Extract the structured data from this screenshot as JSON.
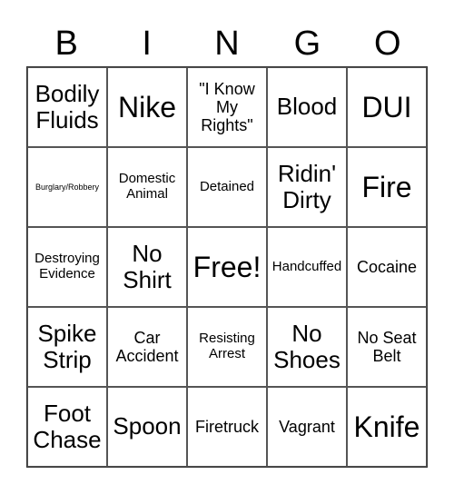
{
  "header": [
    "B",
    "I",
    "N",
    "G",
    "O"
  ],
  "cells": [
    {
      "text": "Bodily Fluids",
      "size": "l"
    },
    {
      "text": "Nike",
      "size": "xl"
    },
    {
      "text": "\"I Know My Rights\"",
      "size": "m"
    },
    {
      "text": "Blood",
      "size": "l"
    },
    {
      "text": "DUI",
      "size": "xl"
    },
    {
      "text": "Burglary/Robbery",
      "size": "xs"
    },
    {
      "text": "Domestic Animal",
      "size": "s"
    },
    {
      "text": "Detained",
      "size": "s"
    },
    {
      "text": "Ridin' Dirty",
      "size": "l"
    },
    {
      "text": "Fire",
      "size": "xl"
    },
    {
      "text": "Destroying Evidence",
      "size": "s"
    },
    {
      "text": "No Shirt",
      "size": "l"
    },
    {
      "text": "Free!",
      "size": "xl"
    },
    {
      "text": "Handcuffed",
      "size": "s"
    },
    {
      "text": "Cocaine",
      "size": "m"
    },
    {
      "text": "Spike Strip",
      "size": "l"
    },
    {
      "text": "Car Accident",
      "size": "m"
    },
    {
      "text": "Resisting Arrest",
      "size": "s"
    },
    {
      "text": "No Shoes",
      "size": "l"
    },
    {
      "text": "No Seat Belt",
      "size": "m"
    },
    {
      "text": "Foot Chase",
      "size": "l"
    },
    {
      "text": "Spoon",
      "size": "l"
    },
    {
      "text": "Firetruck",
      "size": "m"
    },
    {
      "text": "Vagrant",
      "size": "m"
    },
    {
      "text": "Knife",
      "size": "xl"
    }
  ]
}
